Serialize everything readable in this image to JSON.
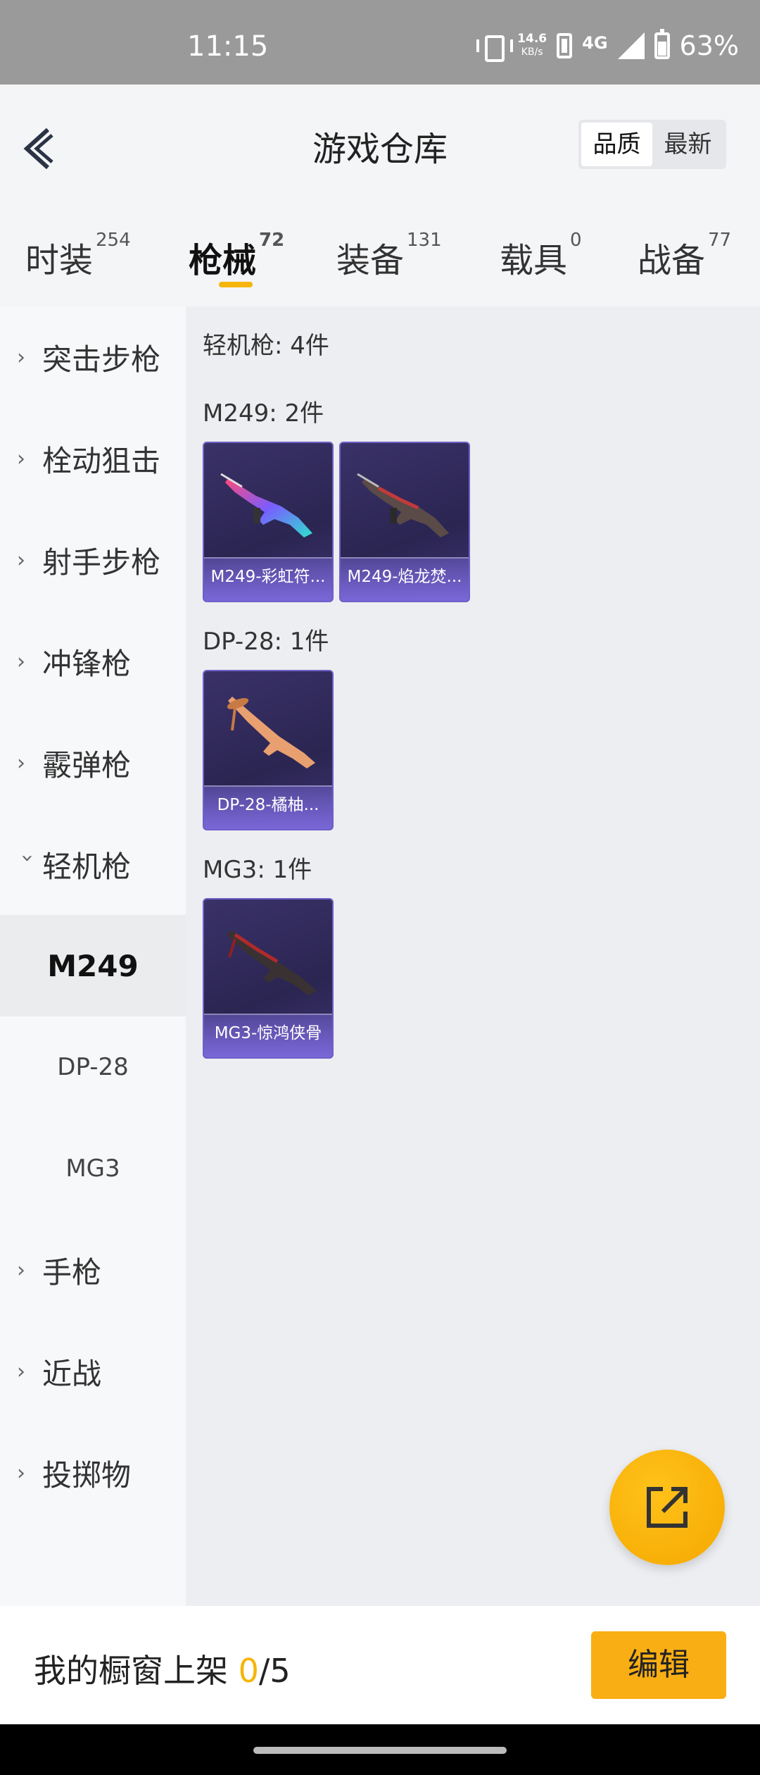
{
  "status_bar": {
    "time": "11:15",
    "speed_value": "14.6",
    "speed_unit": "KB/s",
    "network": "4G",
    "battery": "63%"
  },
  "header": {
    "title": "游戏仓库",
    "sort_options": [
      "品质",
      "最新"
    ],
    "sort_selected": "品质"
  },
  "tabs": [
    {
      "label": "时装",
      "count": "254"
    },
    {
      "label": "枪械",
      "count": "72",
      "active": true
    },
    {
      "label": "装备",
      "count": "131"
    },
    {
      "label": "载具",
      "count": "0"
    },
    {
      "label": "战备",
      "count": "77"
    }
  ],
  "sidebar": {
    "categories": [
      "突击步枪",
      "栓动狙击",
      "射手步枪",
      "冲锋枪",
      "霰弹枪",
      "轻机枪",
      "手枪",
      "近战",
      "投掷物"
    ],
    "expanded": "轻机枪",
    "sub_items": [
      "M249",
      "DP-28",
      "MG3"
    ],
    "sub_active": "M249"
  },
  "content": {
    "summary": "轻机枪: 4件",
    "groups": [
      {
        "title": "M249: 2件",
        "items": [
          "M249-彩虹符...",
          "M249-焰龙焚..."
        ]
      },
      {
        "title": "DP-28: 1件",
        "items": [
          "DP-28-橘柚..."
        ]
      },
      {
        "title": "MG3: 1件",
        "items": [
          "MG3-惊鸿侠骨"
        ]
      }
    ]
  },
  "bottom_bar": {
    "shelf_label": "我的橱窗上架",
    "shelf_current": "0",
    "shelf_total": "/5",
    "edit_label": "编辑"
  },
  "colors": {
    "accent": "#f5b50a",
    "card_bg": "#2b2552",
    "card_label_bg": "#7a67d8"
  },
  "icons": {
    "back": "back-arrow-icon",
    "fab": "share-external-icon"
  }
}
